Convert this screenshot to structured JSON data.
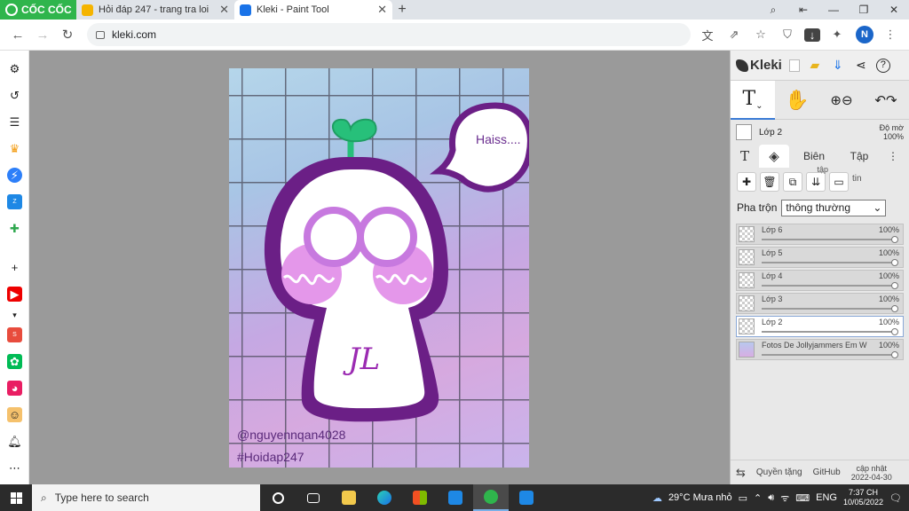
{
  "browser": {
    "brand": "CỐC CỐC",
    "tabs": [
      {
        "title": "Hỏi đáp 247 - trang tra loi",
        "active": false,
        "favicon_color": "#f5b400"
      },
      {
        "title": "Kleki - Paint Tool",
        "active": true,
        "favicon_color": "#1a73e8"
      }
    ],
    "new_tab": "+",
    "url": "kleki.com",
    "profile_initial": "N"
  },
  "canvas": {
    "watermark_user": "@nguyennqan4028",
    "watermark_tag": "#Hoidap247",
    "speech_bubble": "Haiss....",
    "character_text": "JL"
  },
  "kleki": {
    "logo": "Kleki",
    "current_layer_name": "Lớp 2",
    "opacity_label": "Độ mờ",
    "opacity_value": "100%",
    "tabs": {
      "text": "T",
      "edit": "Biên",
      "file": "Tập"
    },
    "action_labels": {
      "merge": "tập",
      "info": "tin"
    },
    "blend_label": "Pha trộn",
    "blend_value": "thông thường",
    "layers": [
      {
        "name": "Lớp 6",
        "opacity": "100%",
        "selected": false
      },
      {
        "name": "Lớp 5",
        "opacity": "100%",
        "selected": false
      },
      {
        "name": "Lớp 4",
        "opacity": "100%",
        "selected": false
      },
      {
        "name": "Lớp 3",
        "opacity": "100%",
        "selected": false
      },
      {
        "name": "Lớp 2",
        "opacity": "100%",
        "selected": true
      },
      {
        "name": "Fotos De Jollyjammers Em W",
        "opacity": "100%",
        "selected": false
      }
    ],
    "footer": {
      "privacy": "Quyền tặng",
      "github": "GitHub",
      "update_label": "cập nhật",
      "update_date": "2022-04-30"
    }
  },
  "taskbar": {
    "search_placeholder": "Type here to search",
    "weather": "29°C  Mưa nhỏ",
    "language": "ENG",
    "time": "7:37 CH",
    "date": "10/05/2022"
  }
}
